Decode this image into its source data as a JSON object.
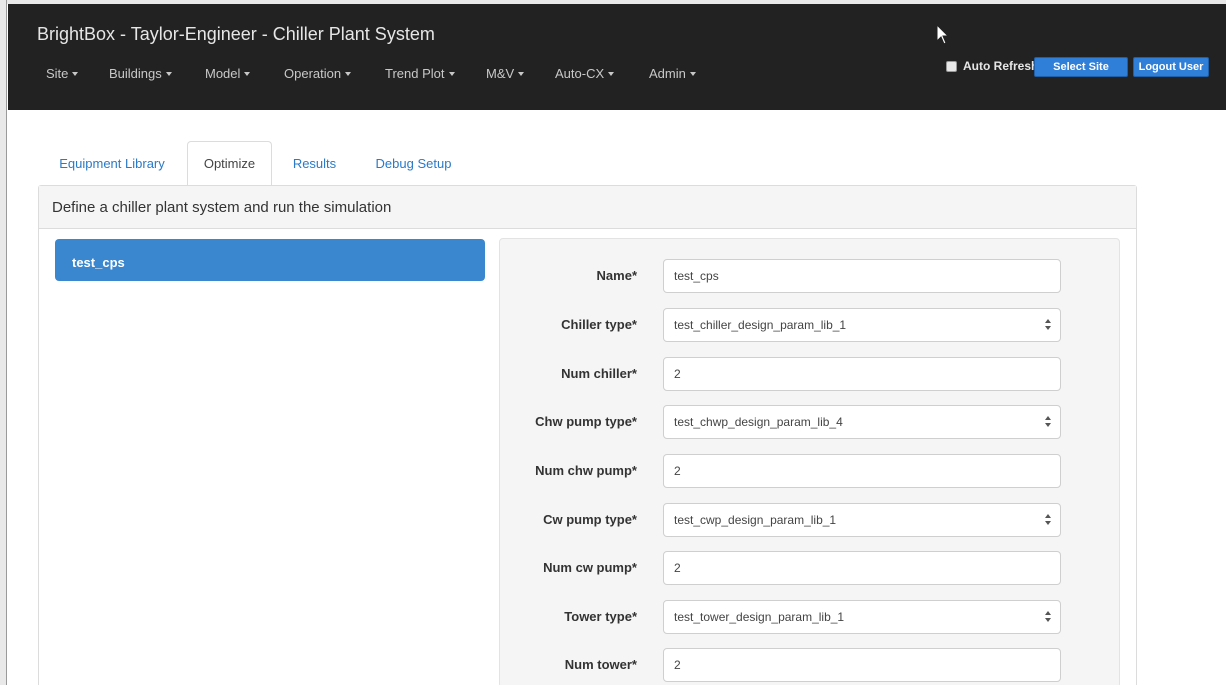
{
  "app": {
    "title": "BrightBox - Taylor-Engineer - Chiller Plant System"
  },
  "nav": {
    "items": [
      {
        "label": "Site"
      },
      {
        "label": "Buildings"
      },
      {
        "label": "Model"
      },
      {
        "label": "Operation"
      },
      {
        "label": "Trend Plot"
      },
      {
        "label": "M&V"
      },
      {
        "label": "Auto-CX"
      },
      {
        "label": "Admin"
      }
    ],
    "auto_refresh_label": "Auto Refresh",
    "select_site_label": "Select Site",
    "logout_label": "Logout User"
  },
  "tabs": [
    {
      "label": "Equipment Library",
      "active": false
    },
    {
      "label": "Optimize",
      "active": true
    },
    {
      "label": "Results",
      "active": false
    },
    {
      "label": "Debug Setup",
      "active": false
    }
  ],
  "panel": {
    "heading": "Define a chiller plant system and run the simulation"
  },
  "list": {
    "selected_item": "test_cps"
  },
  "form": {
    "fields": [
      {
        "label": "Name*",
        "value": "test_cps",
        "type": "input"
      },
      {
        "label": "Chiller type*",
        "value": "test_chiller_design_param_lib_1",
        "type": "select"
      },
      {
        "label": "Num chiller*",
        "value": "2",
        "type": "input"
      },
      {
        "label": "Chw pump type*",
        "value": "test_chwp_design_param_lib_4",
        "type": "select"
      },
      {
        "label": "Num chw pump*",
        "value": "2",
        "type": "input"
      },
      {
        "label": "Cw pump type*",
        "value": "test_cwp_design_param_lib_1",
        "type": "select"
      },
      {
        "label": "Num cw pump*",
        "value": "2",
        "type": "input"
      },
      {
        "label": "Tower type*",
        "value": "test_tower_design_param_lib_1",
        "type": "select"
      },
      {
        "label": "Num tower*",
        "value": "2",
        "type": "input"
      }
    ]
  },
  "colors": {
    "navbar": "#222222",
    "accent": "#2f7ed8",
    "selected_item": "#3b87cf",
    "link": "#2a7ac8"
  }
}
